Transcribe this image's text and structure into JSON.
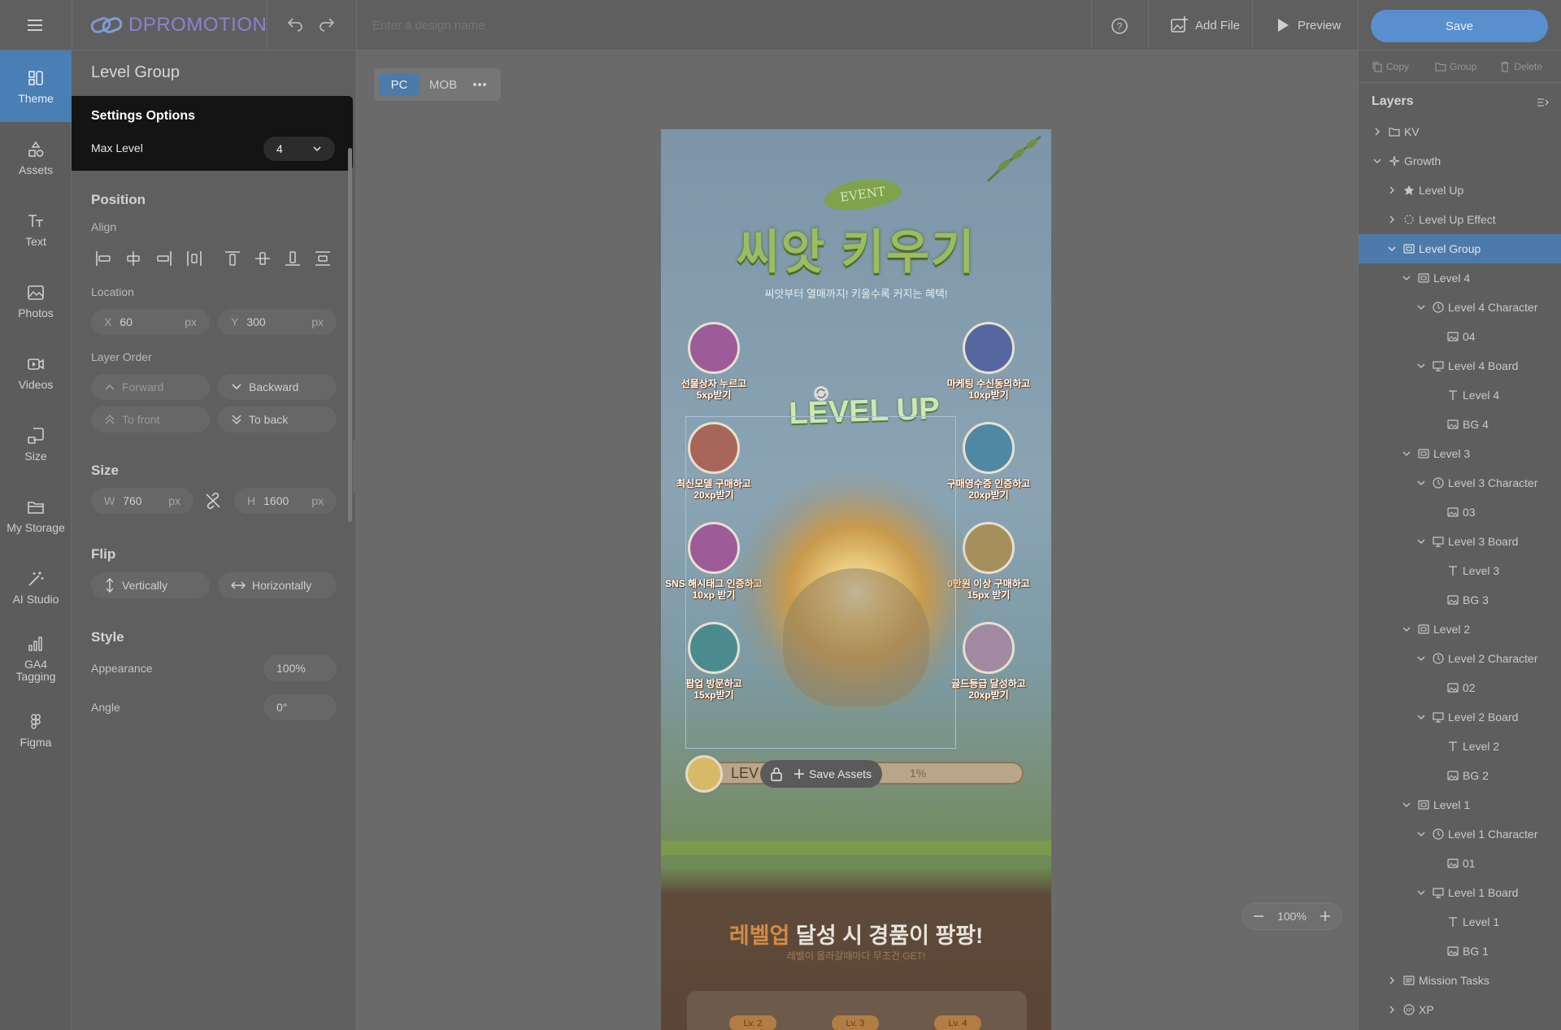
{
  "app": {
    "logo_text": "DPROMOTION",
    "design_name_placeholder": "Enter a design name"
  },
  "topbar": {
    "add_file": "Add File",
    "preview": "Preview",
    "save": "Save"
  },
  "nav": [
    {
      "label": "Theme",
      "icon": "theme-icon"
    },
    {
      "label": "Assets",
      "icon": "assets-icon"
    },
    {
      "label": "Text",
      "icon": "text-icon"
    },
    {
      "label": "Photos",
      "icon": "photos-icon"
    },
    {
      "label": "Videos",
      "icon": "videos-icon"
    },
    {
      "label": "Size",
      "icon": "size-icon"
    },
    {
      "label": "My Storage",
      "icon": "folder-icon"
    },
    {
      "label": "AI Studio",
      "icon": "magic-wand-icon"
    },
    {
      "label": "GA4 Tagging",
      "icon": "bar-chart-icon"
    },
    {
      "label": "Figma",
      "icon": "figma-icon"
    }
  ],
  "panel": {
    "title": "Level Group",
    "settings": {
      "title": "Settings Options",
      "max_level_label": "Max Level",
      "max_level_value": "4"
    },
    "position": {
      "title": "Position",
      "align_label": "Align",
      "location_label": "Location",
      "x_prefix": "X",
      "x_value": "60",
      "y_prefix": "Y",
      "y_value": "300",
      "unit": "px"
    },
    "layer_order": {
      "label": "Layer Order",
      "forward": "Forward",
      "backward": "Backward",
      "to_front": "To front",
      "to_back": "To back"
    },
    "size": {
      "title": "Size",
      "w_prefix": "W",
      "w_value": "760",
      "h_prefix": "H",
      "h_value": "1600",
      "unit": "px"
    },
    "flip": {
      "title": "Flip",
      "vertically": "Vertically",
      "horizontally": "Horizontally"
    },
    "style": {
      "title": "Style",
      "appearance_label": "Appearance",
      "appearance_value": "100%",
      "angle_label": "Angle",
      "angle_value": "0°"
    }
  },
  "canvas": {
    "device_tabs": [
      "PC",
      "MOB"
    ],
    "active_tab": "PC",
    "zoom": "100%",
    "design": {
      "event_badge": "EVENT",
      "title": "씨앗 키우기",
      "subtitle": "씨앗부터 열매까지! 키울수록 커지는 혜택!",
      "missions_left": [
        {
          "line1": "선물상자 누르고",
          "line2": "5xp받기",
          "color": "#c64fb6"
        },
        {
          "line1": "최신모델 구매하고",
          "line2": "20xp받기",
          "color": "#d86b4f"
        },
        {
          "line1": "SNS 해시태그 인증하고",
          "line2": "10xp 받기",
          "color": "#c64fb6"
        },
        {
          "line1": "팝업 방문하고",
          "line2": "15xp받기",
          "color": "#3ea9b6"
        }
      ],
      "missions_right": [
        {
          "line1": "마케팅 수신동의하고",
          "line2": "10xp받기",
          "color": "#4b68c9"
        },
        {
          "line1": "구매영수증 인증하고",
          "line2": "20xp받기",
          "color": "#3aa0c4"
        },
        {
          "line1": "0만원 이상 구매하고",
          "line2": "15px 받기",
          "color": "#d2a54f"
        },
        {
          "line1": "골드등급 달성하고",
          "line2": "20xp받기",
          "color": "#c79ec4"
        }
      ],
      "level_up_text": "LEVEL UP",
      "progress_label": "LEV",
      "progress_percent": "1%",
      "save_assets": "Save Assets",
      "footer_title_highlight": "레벨업",
      "footer_title_rest": " 달성 시 경품이 팡팡!",
      "footer_subtitle": "레벨이 올라갈때마다 무조건 GET!",
      "level_chips": [
        "Lv. 2",
        "Lv. 3",
        "Lv. 4"
      ]
    }
  },
  "layers_panel": {
    "toolbar": {
      "copy": "Copy",
      "group": "Group",
      "delete": "Delete"
    },
    "title": "Layers",
    "rows": [
      {
        "label": "KV",
        "icon": "folder-icon",
        "indent": 0,
        "caret": "right"
      },
      {
        "label": "Growth",
        "icon": "sparkle-icon",
        "indent": 0,
        "caret": "down"
      },
      {
        "label": "Level Up",
        "icon": "star-icon",
        "indent": 1,
        "caret": "right"
      },
      {
        "label": "Level Up Effect",
        "icon": "burst-icon",
        "indent": 1,
        "caret": "right"
      },
      {
        "label": "Level Group",
        "icon": "group-icon",
        "indent": 1,
        "caret": "down",
        "selected": true
      },
      {
        "label": "Level 4",
        "icon": "group-icon",
        "indent": 2,
        "caret": "down"
      },
      {
        "label": "Level 4 Character",
        "icon": "character-icon",
        "indent": 3,
        "caret": "down"
      },
      {
        "label": "04",
        "icon": "image-icon",
        "indent": 4,
        "caret": ""
      },
      {
        "label": "Level 4 Board",
        "icon": "board-icon",
        "indent": 3,
        "caret": "down"
      },
      {
        "label": "Level 4",
        "icon": "text-icon",
        "indent": 4,
        "caret": ""
      },
      {
        "label": "BG 4",
        "icon": "image-icon",
        "indent": 4,
        "caret": ""
      },
      {
        "label": "Level 3",
        "icon": "group-icon",
        "indent": 2,
        "caret": "down"
      },
      {
        "label": "Level 3 Character",
        "icon": "character-icon",
        "indent": 3,
        "caret": "down"
      },
      {
        "label": "03",
        "icon": "image-icon",
        "indent": 4,
        "caret": ""
      },
      {
        "label": "Level 3 Board",
        "icon": "board-icon",
        "indent": 3,
        "caret": "down"
      },
      {
        "label": "Level 3",
        "icon": "text-icon",
        "indent": 4,
        "caret": ""
      },
      {
        "label": "BG 3",
        "icon": "image-icon",
        "indent": 4,
        "caret": ""
      },
      {
        "label": "Level 2",
        "icon": "group-icon",
        "indent": 2,
        "caret": "down"
      },
      {
        "label": "Level 2 Character",
        "icon": "character-icon",
        "indent": 3,
        "caret": "down"
      },
      {
        "label": "02",
        "icon": "image-icon",
        "indent": 4,
        "caret": ""
      },
      {
        "label": "Level 2 Board",
        "icon": "board-icon",
        "indent": 3,
        "caret": "down"
      },
      {
        "label": "Level 2",
        "icon": "text-icon",
        "indent": 4,
        "caret": ""
      },
      {
        "label": "BG 2",
        "icon": "image-icon",
        "indent": 4,
        "caret": ""
      },
      {
        "label": "Level 1",
        "icon": "group-icon",
        "indent": 2,
        "caret": "down"
      },
      {
        "label": "Level 1 Character",
        "icon": "character-icon",
        "indent": 3,
        "caret": "down"
      },
      {
        "label": "01",
        "icon": "image-icon",
        "indent": 4,
        "caret": ""
      },
      {
        "label": "Level 1 Board",
        "icon": "board-icon",
        "indent": 3,
        "caret": "down"
      },
      {
        "label": "Level 1",
        "icon": "text-icon",
        "indent": 4,
        "caret": ""
      },
      {
        "label": "BG 1",
        "icon": "image-icon",
        "indent": 4,
        "caret": ""
      },
      {
        "label": "Mission Tasks",
        "icon": "list-icon",
        "indent": 1,
        "caret": "right"
      },
      {
        "label": "XP",
        "icon": "xp-icon",
        "indent": 1,
        "caret": "right"
      }
    ]
  },
  "colors": {
    "accent": "#4a7fb5",
    "save_button": "#5a8fcf",
    "selected_layer": "#4d7aa8",
    "dark_popup": "#141414",
    "logo": "#7d86c9"
  }
}
